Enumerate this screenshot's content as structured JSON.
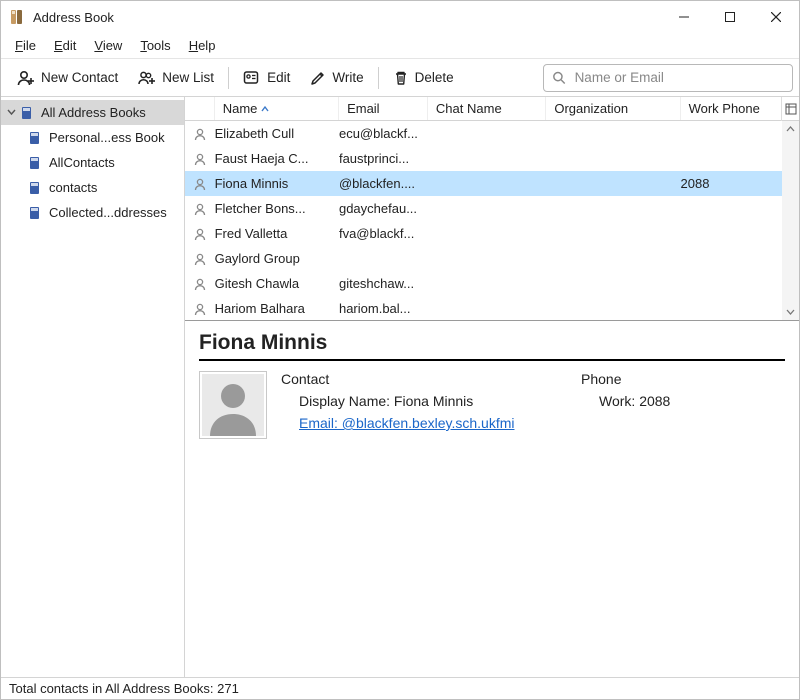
{
  "window": {
    "title": "Address Book"
  },
  "menu": {
    "file": "File",
    "edit": "Edit",
    "view": "View",
    "tools": "Tools",
    "help": "Help"
  },
  "toolbar": {
    "new_contact": "New Contact",
    "new_list": "New List",
    "edit": "Edit",
    "write": "Write",
    "delete": "Delete"
  },
  "search": {
    "placeholder": "Name or Email"
  },
  "sidebar": {
    "root": "All Address Books",
    "items": [
      "Personal...ess Book",
      "AllContacts",
      "contacts",
      "Collected...ddresses"
    ]
  },
  "columns": {
    "name": "Name",
    "email": "Email",
    "chat": "Chat Name",
    "org": "Organization",
    "phone": "Work Phone"
  },
  "rows": [
    {
      "name": "Elizabeth  Cull",
      "email": "ecu@blackf...",
      "chat": "",
      "org": "",
      "phone": ""
    },
    {
      "name": "Faust Haeja C...",
      "email": "faustprinci...",
      "chat": "",
      "org": "",
      "phone": ""
    },
    {
      "name": "Fiona  Minnis",
      "email": "@blackfen....",
      "chat": "",
      "org": "",
      "phone": "2088",
      "selected": true
    },
    {
      "name": "Fletcher Bons...",
      "email": "gdaychefau...",
      "chat": "",
      "org": "",
      "phone": ""
    },
    {
      "name": "Fred  Valletta",
      "email": "fva@blackf...",
      "chat": "",
      "org": "",
      "phone": ""
    },
    {
      "name": "Gaylord Group",
      "email": "",
      "chat": "",
      "org": "",
      "phone": ""
    },
    {
      "name": "Gitesh Chawla",
      "email": "giteshchaw...",
      "chat": "",
      "org": "",
      "phone": ""
    },
    {
      "name": "Hariom Balhara",
      "email": "hariom.bal...",
      "chat": "",
      "org": "",
      "phone": ""
    }
  ],
  "detail": {
    "name": "Fiona Minnis",
    "contact_hdr": "Contact",
    "display_label": "Display Name: Fiona Minnis",
    "email_label": "Email: @blackfen.bexley.sch.ukfmi",
    "phone_hdr": "Phone",
    "work_label": "Work: 2088"
  },
  "status": "Total contacts in All Address Books: 271"
}
